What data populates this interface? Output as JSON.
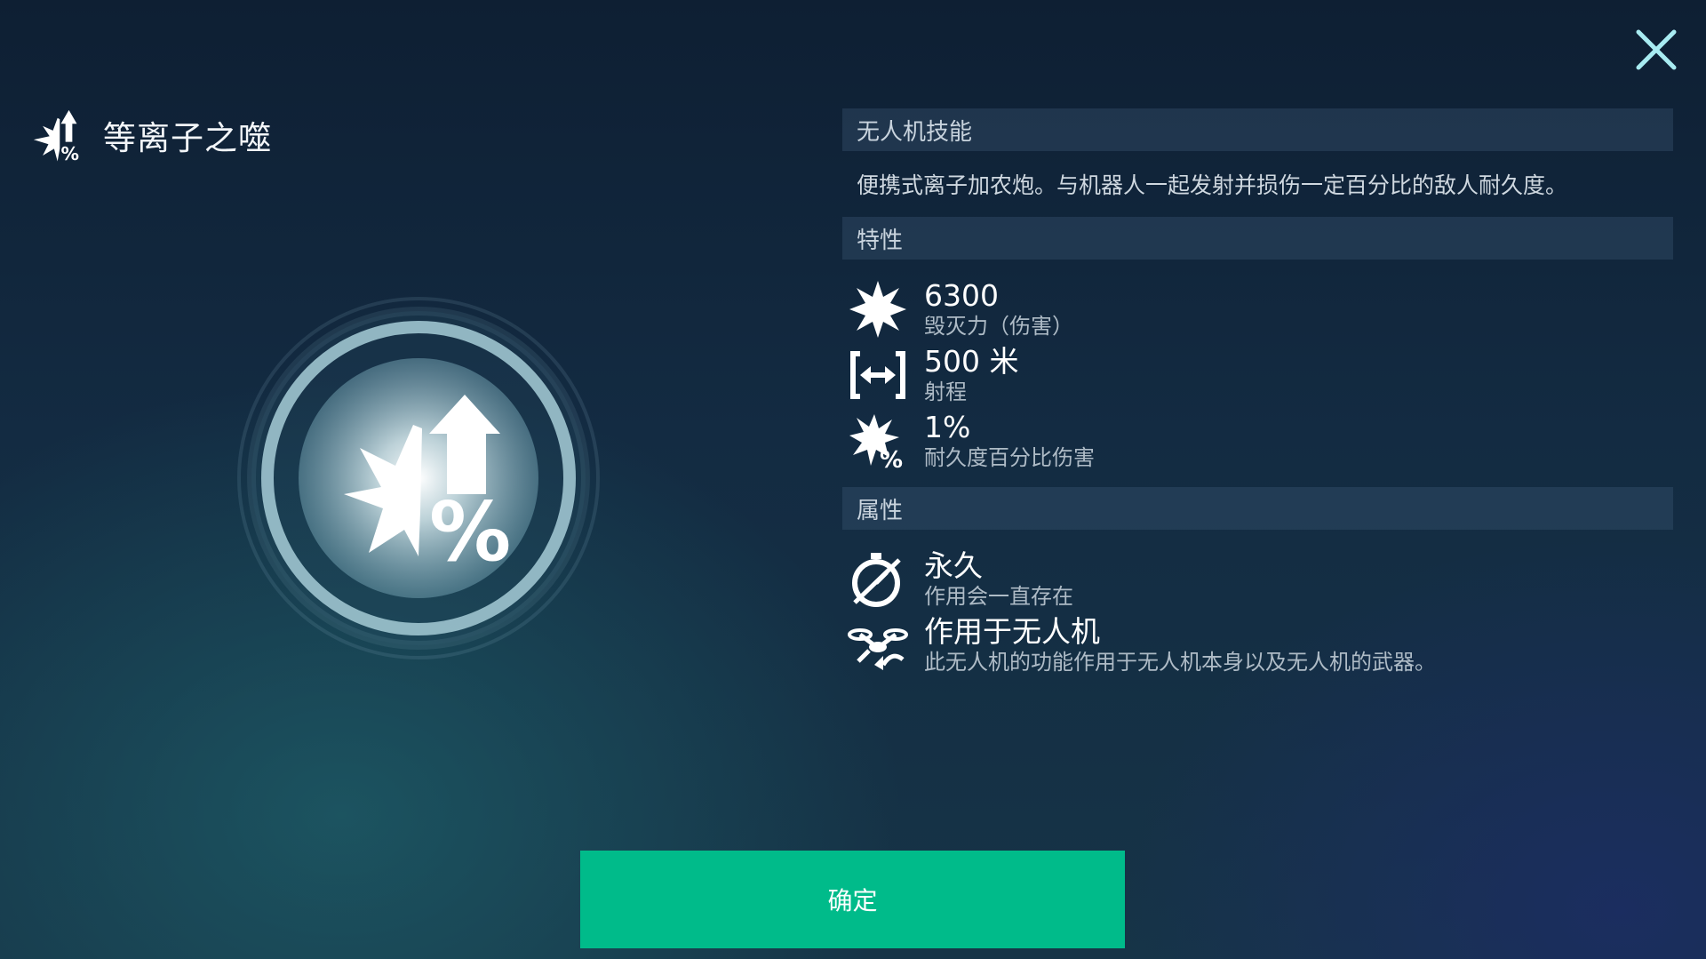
{
  "title": "等离子之噬",
  "close_icon": "close-icon",
  "sections": {
    "skill_header": "无人机技能",
    "description": "便携式离子加农炮。与机器人一起发射并损伤一定百分比的敌人耐久度。",
    "traits_header": "特性",
    "traits": [
      {
        "icon": "explosion-icon",
        "value": "6300",
        "label": "毁灭力（伤害）"
      },
      {
        "icon": "range-icon",
        "value": "500 米",
        "label": "射程"
      },
      {
        "icon": "percent-damage-icon",
        "value": "1%",
        "label": "耐久度百分比伤害"
      }
    ],
    "properties_header": "属性",
    "properties": [
      {
        "icon": "permanent-timer-icon",
        "value": "永久",
        "label": "作用会一直存在"
      },
      {
        "icon": "drone-icon",
        "value": "作用于无人机",
        "label": "此无人机的功能作用于无人机本身以及无人机的武器。"
      }
    ]
  },
  "confirm_label": "确定",
  "colors": {
    "accent": "#00bb8a",
    "background": "#132b42"
  }
}
